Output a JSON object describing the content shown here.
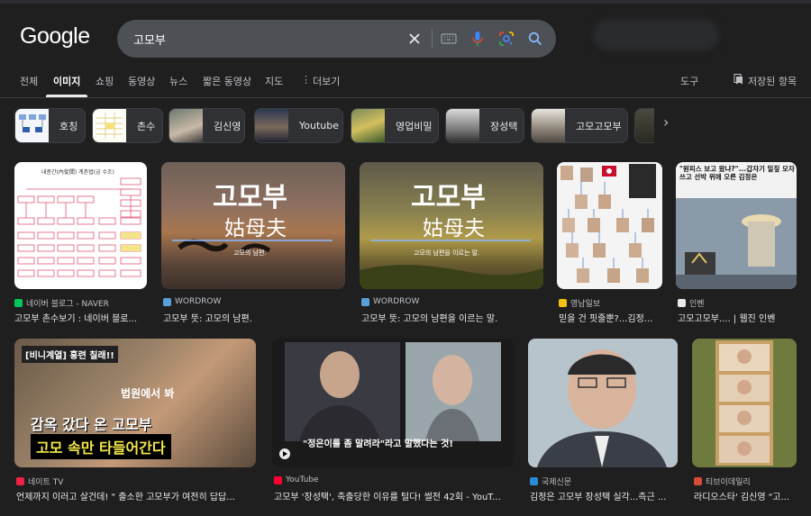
{
  "logo": "Google",
  "search": {
    "query": "고모부"
  },
  "tabs": [
    {
      "label": "전체"
    },
    {
      "label": "이미지"
    },
    {
      "label": "쇼핑"
    },
    {
      "label": "동영상"
    },
    {
      "label": "뉴스"
    },
    {
      "label": "짧은 동영상"
    },
    {
      "label": "지도"
    },
    {
      "label": "더보기"
    }
  ],
  "tools": "도구",
  "saved": "저장된 항목",
  "chips": [
    {
      "label": "호칭"
    },
    {
      "label": "촌수"
    },
    {
      "label": "김신영"
    },
    {
      "label": "Youtube"
    },
    {
      "label": "영업비밀"
    },
    {
      "label": "장성택"
    },
    {
      "label": "고모고모부"
    }
  ],
  "row1": [
    {
      "source": "네이버 블로그 - NAVER",
      "title": "고모부 촌수보기 : 네이버 블로...",
      "img_title": "내종간(內從間) 계촌법(금 수조)"
    },
    {
      "source": "WORDROW",
      "title": "고모부 뜻: 고모의 남편.",
      "big": "고모부",
      "hanja": "姑母夫",
      "caption": "고모의 남편."
    },
    {
      "source": "WORDROW",
      "title": "고모부 뜻: 고모의 남편을 이르는 말.",
      "big": "고모부",
      "hanja": "姑母夫",
      "caption": "고모의 남편을 이르는 말."
    },
    {
      "source": "영남일보",
      "title": "믿을 건 핏줄뿐?...김정..."
    },
    {
      "source": "인벤",
      "title": "고모고모부.... | 웹진 인벤",
      "headline": "\"원피스 보고 왔냐?\"...갑자기 밀짚 모자 쓰고 선박 위에 오른 김정은"
    }
  ],
  "row2": [
    {
      "source": "네이트 TV",
      "title": "언제까지 이러고 살건데! \" 출소한 고모부가 여전히 답답...",
      "tag": "[비니계열] 흥련 칠래!!",
      "line1": "법원에서 봐",
      "line2": "감옥 갔다 온 고모부",
      "line3": "고모 속만 타들어간다"
    },
    {
      "source": "YouTube",
      "title": "고모부 '장성택', 축출당한 이유를 털다! 썰전 42회 - YouT...",
      "sub": "\"정은이를 좀 말려라\"라고 말했다는 것!"
    },
    {
      "source": "국제신문",
      "title": "김정은 고모부 장성택 실각...측근 ..."
    },
    {
      "source": "티브이데일리",
      "title": "라디오스타' 김신영 \"고..."
    }
  ],
  "colors": {
    "bg": "#1f1f1f",
    "searchbar": "#4d5156",
    "accent_blue": "#8ab4f8"
  }
}
